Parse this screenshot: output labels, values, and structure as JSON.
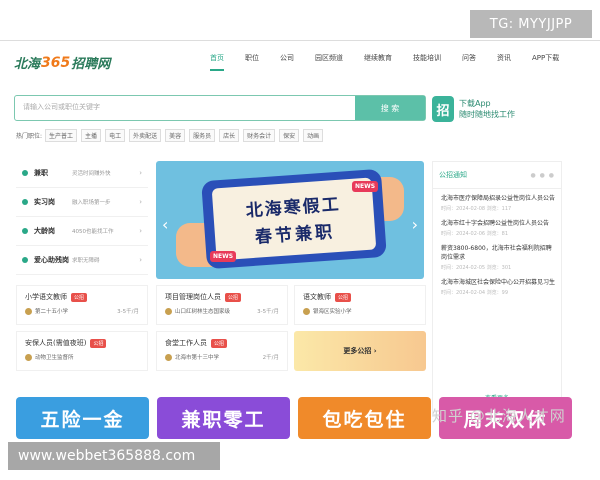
{
  "overlay": {
    "tg": "TG: MYYJJPP",
    "website": "www.webbet365888.com",
    "watermark": "知乎 @北海人才网"
  },
  "header": {
    "logo": {
      "pre": "北海",
      "num": "365",
      "post": "招聘网"
    },
    "nav": [
      "首页",
      "职位",
      "公司",
      "园区频道",
      "继续教育",
      "技能培训",
      "问答",
      "资讯",
      "APP下载"
    ]
  },
  "search": {
    "placeholder": "请输入公司或职位关键字",
    "button": "搜 索"
  },
  "app": {
    "icon": "招",
    "line1": "下载App",
    "line2": "随时随地找工作"
  },
  "hot": {
    "label": "热门职位:",
    "tags": [
      "生产普工",
      "主播",
      "电工",
      "外卖配送",
      "美容",
      "服务员",
      "店长",
      "财务会计",
      "保安",
      "动画"
    ]
  },
  "left_items": [
    {
      "name": "兼职",
      "desc": "灵活时间赚外快"
    },
    {
      "name": "实习岗",
      "desc": "融入职场第一步"
    },
    {
      "name": "大龄岗",
      "desc": "4050也能找工作"
    },
    {
      "name": "爱心助残岗",
      "desc": "求职无障碍"
    }
  ],
  "banner": {
    "line1": "北海寒假工",
    "line2": "春节兼职",
    "badge": "NEWS"
  },
  "notice": {
    "title": "公招通知",
    "items": [
      {
        "title": "北海市医疗保障局招录公益性岗位人员公告",
        "meta": "时间：2024-02-08 浏览：117"
      },
      {
        "title": "北海市红十字会招聘公益性岗位人员公告",
        "meta": "时间：2024-02-06 浏览：81"
      },
      {
        "title": "薪资3800-6800，北海市社会福利院招聘岗位需求",
        "meta": "时间：2024-02-05 浏览：301"
      },
      {
        "title": "北海市海城区社会保险中心公开招募见习生",
        "meta": "时间：2024-02-04 浏览：99"
      }
    ],
    "more": "查看更多"
  },
  "jobs": [
    {
      "name": "小学语文教师",
      "badge": "公招",
      "company": "第二十五小学",
      "salary": "3-5千/月"
    },
    {
      "name": "项目管理岗位人员",
      "badge": "公招",
      "company": "山口红树林生态国家级",
      "salary": "3-5千/月"
    },
    {
      "name": "语文教师",
      "badge": "公招",
      "company": "银海区实验小学",
      "salary": ""
    },
    {
      "name": "安保人员(需值夜班)",
      "badge": "公招",
      "company": "动物卫生监督所",
      "salary": ""
    },
    {
      "name": "食堂工作人员",
      "badge": "公招",
      "company": "北海市第十三中学",
      "salary": "2千/月"
    }
  ],
  "more_jobs": "更多公招 ›",
  "cards": [
    {
      "text": "五险一金",
      "color": "#3a9ee0"
    },
    {
      "text": "兼职零工",
      "color": "#8a4cd8"
    },
    {
      "text": "包吃包住",
      "color": "#f08a2a"
    },
    {
      "text": "周末双休",
      "color": "#d85aa8"
    }
  ]
}
